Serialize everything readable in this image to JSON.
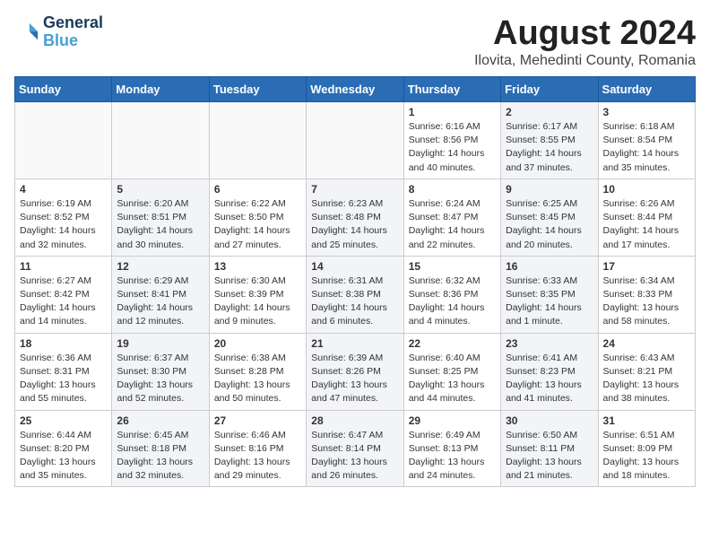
{
  "header": {
    "logo_line1": "General",
    "logo_line2": "Blue",
    "month": "August 2024",
    "location": "Ilovita, Mehedinti County, Romania"
  },
  "days_of_week": [
    "Sunday",
    "Monday",
    "Tuesday",
    "Wednesday",
    "Thursday",
    "Friday",
    "Saturday"
  ],
  "weeks": [
    [
      {
        "day": "",
        "info": "",
        "empty": true
      },
      {
        "day": "",
        "info": "",
        "empty": true
      },
      {
        "day": "",
        "info": "",
        "empty": true
      },
      {
        "day": "",
        "info": "",
        "empty": true
      },
      {
        "day": "1",
        "info": "Sunrise: 6:16 AM\nSunset: 8:56 PM\nDaylight: 14 hours\nand 40 minutes.",
        "empty": false,
        "shaded": false
      },
      {
        "day": "2",
        "info": "Sunrise: 6:17 AM\nSunset: 8:55 PM\nDaylight: 14 hours\nand 37 minutes.",
        "empty": false,
        "shaded": true
      },
      {
        "day": "3",
        "info": "Sunrise: 6:18 AM\nSunset: 8:54 PM\nDaylight: 14 hours\nand 35 minutes.",
        "empty": false,
        "shaded": false
      }
    ],
    [
      {
        "day": "4",
        "info": "Sunrise: 6:19 AM\nSunset: 8:52 PM\nDaylight: 14 hours\nand 32 minutes.",
        "empty": false,
        "shaded": false
      },
      {
        "day": "5",
        "info": "Sunrise: 6:20 AM\nSunset: 8:51 PM\nDaylight: 14 hours\nand 30 minutes.",
        "empty": false,
        "shaded": true
      },
      {
        "day": "6",
        "info": "Sunrise: 6:22 AM\nSunset: 8:50 PM\nDaylight: 14 hours\nand 27 minutes.",
        "empty": false,
        "shaded": false
      },
      {
        "day": "7",
        "info": "Sunrise: 6:23 AM\nSunset: 8:48 PM\nDaylight: 14 hours\nand 25 minutes.",
        "empty": false,
        "shaded": true
      },
      {
        "day": "8",
        "info": "Sunrise: 6:24 AM\nSunset: 8:47 PM\nDaylight: 14 hours\nand 22 minutes.",
        "empty": false,
        "shaded": false
      },
      {
        "day": "9",
        "info": "Sunrise: 6:25 AM\nSunset: 8:45 PM\nDaylight: 14 hours\nand 20 minutes.",
        "empty": false,
        "shaded": true
      },
      {
        "day": "10",
        "info": "Sunrise: 6:26 AM\nSunset: 8:44 PM\nDaylight: 14 hours\nand 17 minutes.",
        "empty": false,
        "shaded": false
      }
    ],
    [
      {
        "day": "11",
        "info": "Sunrise: 6:27 AM\nSunset: 8:42 PM\nDaylight: 14 hours\nand 14 minutes.",
        "empty": false,
        "shaded": false
      },
      {
        "day": "12",
        "info": "Sunrise: 6:29 AM\nSunset: 8:41 PM\nDaylight: 14 hours\nand 12 minutes.",
        "empty": false,
        "shaded": true
      },
      {
        "day": "13",
        "info": "Sunrise: 6:30 AM\nSunset: 8:39 PM\nDaylight: 14 hours\nand 9 minutes.",
        "empty": false,
        "shaded": false
      },
      {
        "day": "14",
        "info": "Sunrise: 6:31 AM\nSunset: 8:38 PM\nDaylight: 14 hours\nand 6 minutes.",
        "empty": false,
        "shaded": true
      },
      {
        "day": "15",
        "info": "Sunrise: 6:32 AM\nSunset: 8:36 PM\nDaylight: 14 hours\nand 4 minutes.",
        "empty": false,
        "shaded": false
      },
      {
        "day": "16",
        "info": "Sunrise: 6:33 AM\nSunset: 8:35 PM\nDaylight: 14 hours\nand 1 minute.",
        "empty": false,
        "shaded": true
      },
      {
        "day": "17",
        "info": "Sunrise: 6:34 AM\nSunset: 8:33 PM\nDaylight: 13 hours\nand 58 minutes.",
        "empty": false,
        "shaded": false
      }
    ],
    [
      {
        "day": "18",
        "info": "Sunrise: 6:36 AM\nSunset: 8:31 PM\nDaylight: 13 hours\nand 55 minutes.",
        "empty": false,
        "shaded": false
      },
      {
        "day": "19",
        "info": "Sunrise: 6:37 AM\nSunset: 8:30 PM\nDaylight: 13 hours\nand 52 minutes.",
        "empty": false,
        "shaded": true
      },
      {
        "day": "20",
        "info": "Sunrise: 6:38 AM\nSunset: 8:28 PM\nDaylight: 13 hours\nand 50 minutes.",
        "empty": false,
        "shaded": false
      },
      {
        "day": "21",
        "info": "Sunrise: 6:39 AM\nSunset: 8:26 PM\nDaylight: 13 hours\nand 47 minutes.",
        "empty": false,
        "shaded": true
      },
      {
        "day": "22",
        "info": "Sunrise: 6:40 AM\nSunset: 8:25 PM\nDaylight: 13 hours\nand 44 minutes.",
        "empty": false,
        "shaded": false
      },
      {
        "day": "23",
        "info": "Sunrise: 6:41 AM\nSunset: 8:23 PM\nDaylight: 13 hours\nand 41 minutes.",
        "empty": false,
        "shaded": true
      },
      {
        "day": "24",
        "info": "Sunrise: 6:43 AM\nSunset: 8:21 PM\nDaylight: 13 hours\nand 38 minutes.",
        "empty": false,
        "shaded": false
      }
    ],
    [
      {
        "day": "25",
        "info": "Sunrise: 6:44 AM\nSunset: 8:20 PM\nDaylight: 13 hours\nand 35 minutes.",
        "empty": false,
        "shaded": false
      },
      {
        "day": "26",
        "info": "Sunrise: 6:45 AM\nSunset: 8:18 PM\nDaylight: 13 hours\nand 32 minutes.",
        "empty": false,
        "shaded": true
      },
      {
        "day": "27",
        "info": "Sunrise: 6:46 AM\nSunset: 8:16 PM\nDaylight: 13 hours\nand 29 minutes.",
        "empty": false,
        "shaded": false
      },
      {
        "day": "28",
        "info": "Sunrise: 6:47 AM\nSunset: 8:14 PM\nDaylight: 13 hours\nand 26 minutes.",
        "empty": false,
        "shaded": true
      },
      {
        "day": "29",
        "info": "Sunrise: 6:49 AM\nSunset: 8:13 PM\nDaylight: 13 hours\nand 24 minutes.",
        "empty": false,
        "shaded": false
      },
      {
        "day": "30",
        "info": "Sunrise: 6:50 AM\nSunset: 8:11 PM\nDaylight: 13 hours\nand 21 minutes.",
        "empty": false,
        "shaded": true
      },
      {
        "day": "31",
        "info": "Sunrise: 6:51 AM\nSunset: 8:09 PM\nDaylight: 13 hours\nand 18 minutes.",
        "empty": false,
        "shaded": false
      }
    ]
  ]
}
